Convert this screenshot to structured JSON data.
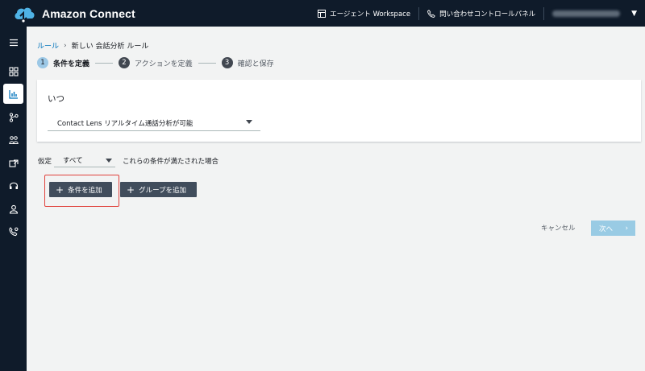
{
  "header": {
    "app_title": "Amazon Connect",
    "agent_workspace_label": "エージェント Workspace",
    "ccp_label": "問い合わせコントロールパネル",
    "account_caret": "▼"
  },
  "sidebar": {
    "items": [
      {
        "icon": "menu-icon"
      },
      {
        "icon": "dashboard-icon"
      },
      {
        "icon": "analytics-icon",
        "active": true
      },
      {
        "icon": "routing-icon"
      },
      {
        "icon": "users-icon"
      },
      {
        "icon": "channels-icon"
      },
      {
        "icon": "headset-icon"
      },
      {
        "icon": "user-icon"
      },
      {
        "icon": "phone-flow-icon"
      }
    ]
  },
  "breadcrumb": {
    "root": "ルール",
    "separator": "›",
    "current": "新しい 会話分析 ルール"
  },
  "steps": [
    {
      "num": "1",
      "label": "条件を定義",
      "active": true
    },
    {
      "num": "2",
      "label": "アクションを定義",
      "active": false
    },
    {
      "num": "3",
      "label": "確認と保存",
      "active": false
    }
  ],
  "when_card": {
    "title": "いつ",
    "select_value": "Contact Lens リアルタイム通話分析が可能"
  },
  "condition": {
    "prefix": "仮定",
    "select_value": "すべて",
    "suffix": "これらの条件が満たされた場合"
  },
  "buttons": {
    "add_condition": "条件を追加",
    "add_group": "グループを追加",
    "plus": "+",
    "cancel": "キャンセル",
    "next": "次へ",
    "next_chevron": "›"
  },
  "colors": {
    "nav_bg": "#0f1b2a",
    "page_bg": "#f2f3f3",
    "link": "#0073bb",
    "highlight": "#e0413c",
    "primary_disabled": "#99cbe4",
    "dark_button": "#414d5c"
  }
}
